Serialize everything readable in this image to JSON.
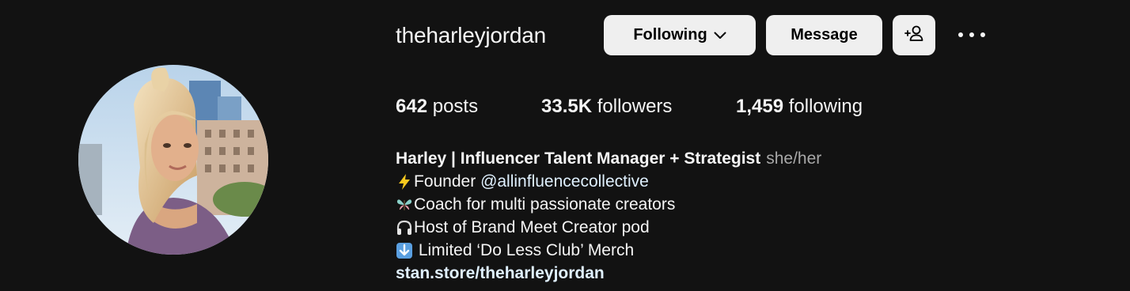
{
  "profile": {
    "username": "theharleyjordan",
    "avatar_alt": "profile-photo"
  },
  "actions": {
    "following_label": "Following",
    "message_label": "Message",
    "suggest_icon": "person-add-icon",
    "more_icon": "more-horizontal-icon"
  },
  "stats": {
    "posts_count": "642",
    "posts_label": "posts",
    "followers_count": "33.5K",
    "followers_label": "followers",
    "following_count": "1,459",
    "following_label": "following"
  },
  "bio": {
    "name": "Harley | Influencer Talent Manager + Strategist",
    "pronouns": "she/her",
    "line1_prefix": "Founder ",
    "line1_mention": "@allinfluencecollective",
    "line2": "Coach for multi passionate creators",
    "line3": "Host of Brand Meet Creator pod",
    "line4": " Limited ‘Do Less Club’ Merch",
    "link": "stan.store/theharleyjordan",
    "emojis": [
      "lightning-emoji",
      "butterfly-emoji",
      "headphones-emoji",
      "down-arrow-emoji"
    ]
  },
  "colors": {
    "background": "#121212",
    "button_bg": "#efefef",
    "link": "#e0f1ff",
    "secondary_text": "#a8a8a8"
  }
}
